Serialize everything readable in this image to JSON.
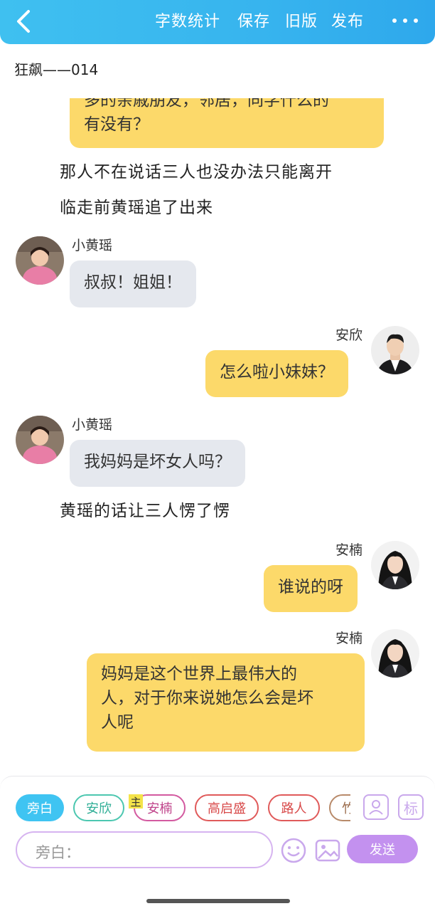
{
  "header": {
    "buttons": [
      "字数统计",
      "保存",
      "旧版",
      "发布"
    ]
  },
  "chapter_title": "狂飙——014",
  "messages": {
    "partial_top": {
      "line1": "多的亲戚朋友，邻居，同学什么的",
      "line2": "有没有？"
    },
    "narration1": "那人不在说话三人也没办法只能离开",
    "narration2": "临走前黄瑶追了出来",
    "m1": {
      "speaker": "小黄瑶",
      "text": "叔叔！姐姐！"
    },
    "m2": {
      "speaker": "安欣",
      "text": "怎么啦小妹妹？"
    },
    "m3": {
      "speaker": "小黄瑶",
      "text": "我妈妈是坏女人吗？"
    },
    "narration3": "黄瑶的话让三人愣了愣",
    "m4": {
      "speaker": "安楠",
      "text": "谁说的呀"
    },
    "m5": {
      "speaker": "安楠",
      "line1": "妈妈是这个世界上最伟大的",
      "line2": "人，对于你来说她怎么会是坏",
      "line3": "人呢"
    }
  },
  "roles": {
    "chips": [
      "旁白",
      "安欣",
      "安楠",
      "高启盛",
      "路人",
      "竹"
    ],
    "main_badge": "主"
  },
  "side_icons": {
    "tag_label": "标"
  },
  "input": {
    "placeholder": "旁白："
  },
  "send_label": "发送",
  "colors": {
    "header": "#37b4ee",
    "bubble_yellow": "#fcd96a",
    "bubble_gray": "#e5e8ee",
    "send": "#c391ef"
  }
}
